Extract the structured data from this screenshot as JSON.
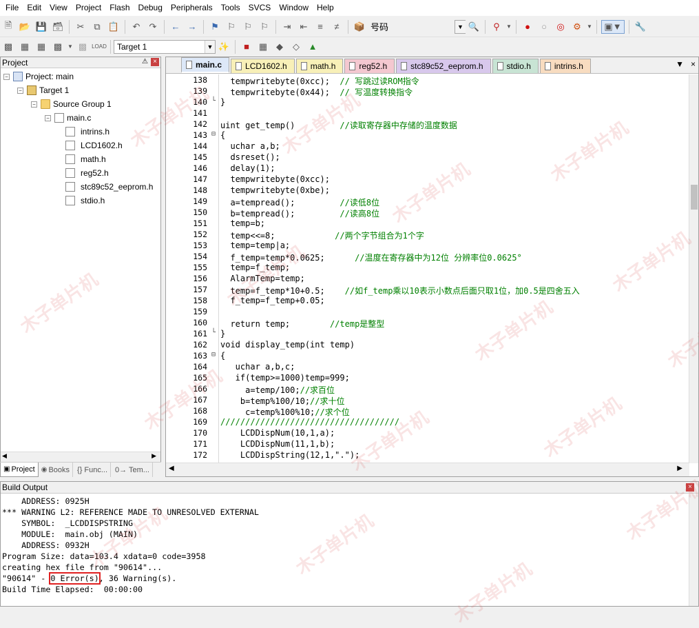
{
  "menu": [
    "File",
    "Edit",
    "View",
    "Project",
    "Flash",
    "Debug",
    "Peripherals",
    "Tools",
    "SVCS",
    "Window",
    "Help"
  ],
  "toolbar": {
    "find_text": "号码",
    "target": "Target 1"
  },
  "project_panel": {
    "title": "Project",
    "root": "Project: main",
    "target": "Target 1",
    "group": "Source Group 1",
    "file": "main.c",
    "includes": [
      "intrins.h",
      "LCD1602.h",
      "math.h",
      "reg52.h",
      "stc89c52_eeprom.h",
      "stdio.h"
    ],
    "tabs": [
      "Project",
      "Books",
      "{} Func...",
      "0→ Tem..."
    ]
  },
  "editor": {
    "tabs": [
      {
        "label": "main.c",
        "color": "#dde8f8"
      },
      {
        "label": "LCD1602.h",
        "color": "#f8f0b8"
      },
      {
        "label": "math.h",
        "color": "#f8f0b8"
      },
      {
        "label": "reg52.h",
        "color": "#f4c8d0"
      },
      {
        "label": "stc89c52_eeprom.h",
        "color": "#d8c8ec"
      },
      {
        "label": "stdio.h",
        "color": "#c8e4d4"
      },
      {
        "label": "intrins.h",
        "color": "#f8dcc0"
      }
    ],
    "lines": [
      {
        "n": "138",
        "t": "  tempwritebyte(0xcc);  ",
        "c": "// 写跳过读ROM指令"
      },
      {
        "n": "139",
        "t": "  tempwritebyte(0x44);  ",
        "c": "// 写温度转换指令"
      },
      {
        "n": "140",
        "t": "}",
        "c": ""
      },
      {
        "n": "141",
        "t": "",
        "c": ""
      },
      {
        "n": "142",
        "t": "uint get_temp()         ",
        "c": "//读取寄存器中存储的温度数据"
      },
      {
        "n": "143",
        "t": "{",
        "c": ""
      },
      {
        "n": "144",
        "t": "  uchar a,b;",
        "c": ""
      },
      {
        "n": "145",
        "t": "  dsreset();",
        "c": ""
      },
      {
        "n": "146",
        "t": "  delay(1);",
        "c": ""
      },
      {
        "n": "147",
        "t": "  tempwritebyte(0xcc);",
        "c": ""
      },
      {
        "n": "148",
        "t": "  tempwritebyte(0xbe);",
        "c": ""
      },
      {
        "n": "149",
        "t": "  a=tempread();         ",
        "c": "//读低8位"
      },
      {
        "n": "150",
        "t": "  b=tempread();         ",
        "c": "//读高8位"
      },
      {
        "n": "151",
        "t": "  temp=b;",
        "c": ""
      },
      {
        "n": "152",
        "t": "  temp<<=8;            ",
        "c": "//两个字节组合为1个字"
      },
      {
        "n": "153",
        "t": "  temp=temp|a;",
        "c": ""
      },
      {
        "n": "154",
        "t": "  f_temp=temp*0.0625;      ",
        "c": "//温度在寄存器中为12位 分辨率位0.0625°"
      },
      {
        "n": "155",
        "t": "  temp=f_temp;",
        "c": ""
      },
      {
        "n": "156",
        "t": "  AlarmTemp=temp;",
        "c": ""
      },
      {
        "n": "157",
        "t": "  temp=f_temp*10+0.5;    ",
        "c": "//如f_temp乘以10表示小数点后面只取1位，加0.5是四舍五入"
      },
      {
        "n": "158",
        "t": "  f_temp=f_temp+0.05;",
        "c": ""
      },
      {
        "n": "159",
        "t": "",
        "c": ""
      },
      {
        "n": "160",
        "t": "  return temp;        ",
        "c": "//temp是整型"
      },
      {
        "n": "161",
        "t": "}",
        "c": ""
      },
      {
        "n": "162",
        "t": "void display_temp(int temp)",
        "c": ""
      },
      {
        "n": "163",
        "t": "{",
        "c": ""
      },
      {
        "n": "164",
        "t": "   uchar a,b,c;",
        "c": ""
      },
      {
        "n": "165",
        "t": "   if(temp>=1000)temp=999;",
        "c": ""
      },
      {
        "n": "166",
        "t": "     a=temp/100;",
        "c": "//求百位"
      },
      {
        "n": "167",
        "t": "    b=temp%100/10;",
        "c": "//求十位"
      },
      {
        "n": "168",
        "t": "     c=temp%100%10;",
        "c": "//求个位"
      },
      {
        "n": "169",
        "t": "",
        "c": "////////////////////////////////////"
      },
      {
        "n": "170",
        "t": "    LCDDispNum(10,1,a);",
        "c": ""
      },
      {
        "n": "171",
        "t": "    LCDDispNum(11,1,b);",
        "c": ""
      },
      {
        "n": "172",
        "t": "    LCDDispString(12,1,\".\");",
        "c": ""
      }
    ]
  },
  "build_output": {
    "title": "Build Output",
    "lines": [
      "    ADDRESS: 0925H",
      "*** WARNING L2: REFERENCE MADE TO UNRESOLVED EXTERNAL",
      "    SYMBOL:  _LCDDISPSTRING",
      "    MODULE:  main.obj (MAIN)",
      "    ADDRESS: 0932H",
      "Program Size: data=103.4 xdata=0 code=3958",
      "creating hex file from \"90614\"..."
    ],
    "summary_prefix": "\"90614\" - ",
    "summary_errors": "0 Error(s)",
    "summary_suffix": ", 36 Warning(s).",
    "elapsed": "Build Time Elapsed:  00:00:00"
  },
  "watermark": "木子单片机"
}
